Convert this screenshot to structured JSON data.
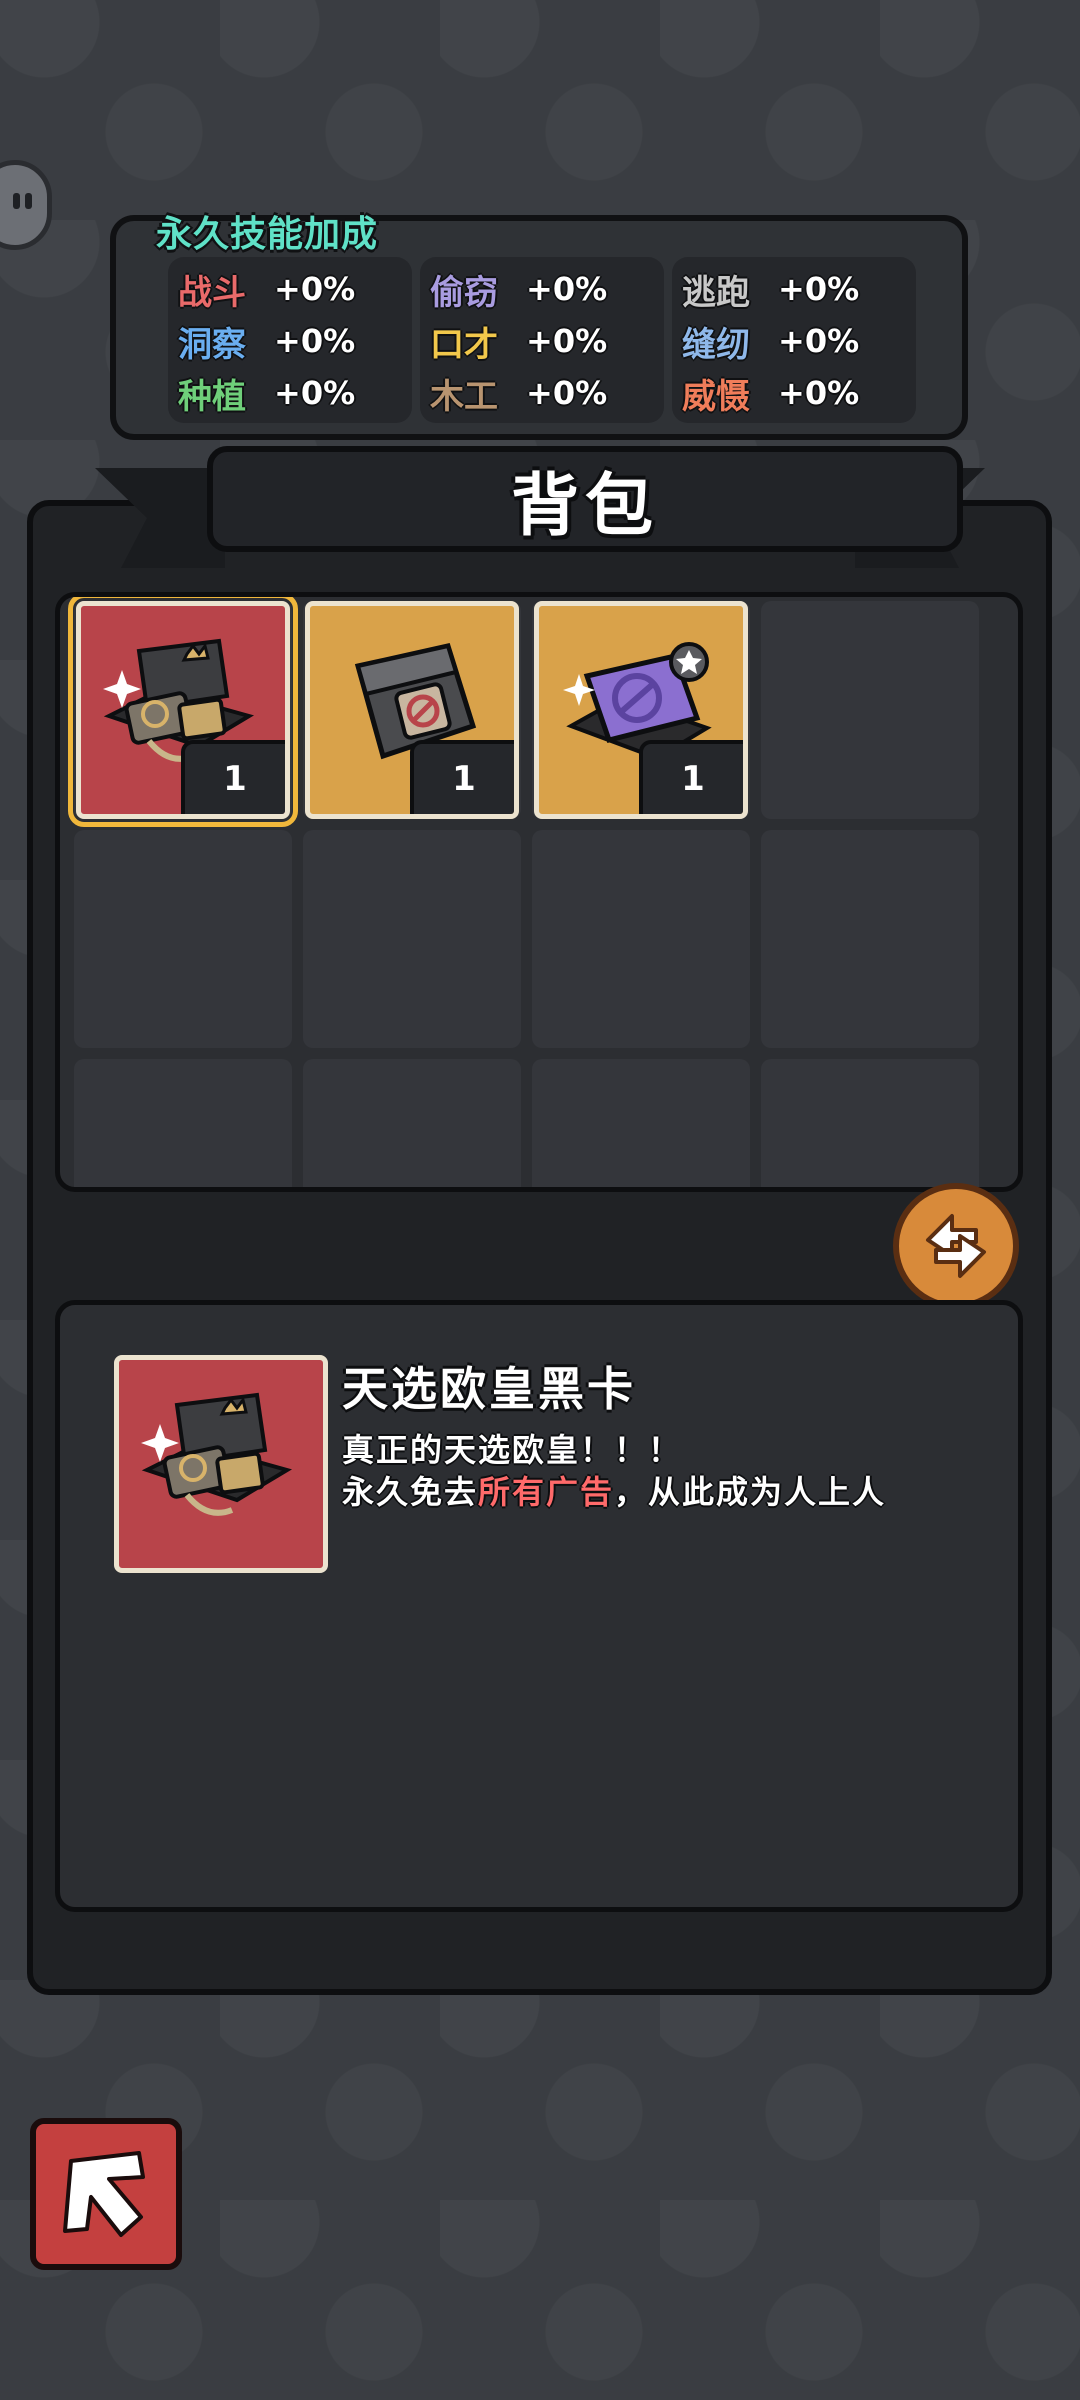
{
  "skills_panel": {
    "title": "永久技能加成",
    "columns": [
      [
        {
          "name": "战斗",
          "value": "+0%",
          "color": "#e96a6a"
        },
        {
          "name": "洞察",
          "value": "+0%",
          "color": "#6aaef0"
        },
        {
          "name": "种植",
          "value": "+0%",
          "color": "#6fcf7a"
        }
      ],
      [
        {
          "name": "偷窃",
          "value": "+0%",
          "color": "#a99ce0"
        },
        {
          "name": "口才",
          "value": "+0%",
          "color": "#f2c84b"
        },
        {
          "name": "木工",
          "value": "+0%",
          "color": "#b89470"
        }
      ],
      [
        {
          "name": "逃跑",
          "value": "+0%",
          "color": "#c8c8c8"
        },
        {
          "name": "缝纫",
          "value": "+0%",
          "color": "#8fb8ea"
        },
        {
          "name": "威慑",
          "value": "+0%",
          "color": "#f07d5a"
        }
      ]
    ]
  },
  "bag": {
    "title": "背包",
    "items": [
      {
        "icon": "black-card-giftbox-icon",
        "count": "1",
        "card_color": "red",
        "selected": true
      },
      {
        "icon": "sealed-box-icon",
        "count": "1",
        "card_color": "gold",
        "selected": false
      },
      {
        "icon": "purple-card-box-icon",
        "count": "1",
        "card_color": "gold",
        "selected": false
      }
    ],
    "total_slots": 12
  },
  "swap_button": {
    "icon": "swap-arrows-icon"
  },
  "description": {
    "name": "天选欧皇黑卡",
    "line1": "真正的天选欧皇！！！",
    "line2_prefix": "永久免去",
    "line2_highlight": "所有广告",
    "line2_suffix": "，从此成为人上人",
    "highlight_color": "#ff6a6a"
  },
  "back_button": {
    "icon": "back-arrow-icon"
  }
}
